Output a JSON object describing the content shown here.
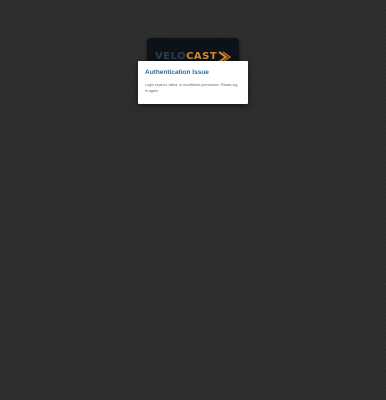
{
  "logo": {
    "part1": "VELO",
    "part2": "CAST"
  },
  "dialog": {
    "title": "Authentication Issue",
    "message": "Login expired, failed, or insufficient permission. Please log in again."
  },
  "colors": {
    "background": "#2d2d2d",
    "dialog_title": "#2f6aa3",
    "logo_accent": "#d48a2a"
  },
  "icons": {
    "logo_mark": "chevron-arrow-icon"
  }
}
